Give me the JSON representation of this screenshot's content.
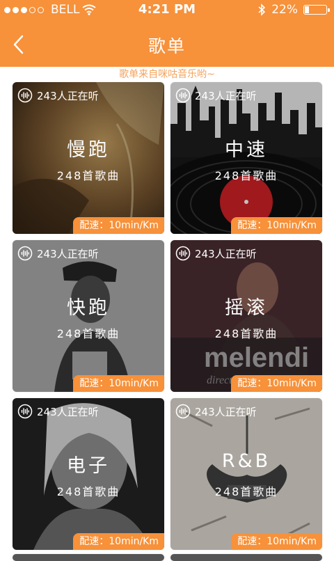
{
  "status_bar": {
    "carrier": "BELL",
    "time": "4:21 PM",
    "battery": "22%",
    "battery_level": 0.22,
    "signal_bars_filled": 3,
    "signal_bars_total": 5
  },
  "nav": {
    "title": "歌单"
  },
  "subtitle": "歌单来自咪咕音乐哟~",
  "colors": {
    "accent": "#f7913a",
    "subtitle": "#f4a35c"
  },
  "playlists": [
    {
      "listeners": "243人正在听",
      "title": "慢跑",
      "count": "248首歌曲",
      "pace": "配速：10min/Km"
    },
    {
      "listeners": "243人正在听",
      "title": "中速",
      "count": "248首歌曲",
      "pace": "配速：10min/Km"
    },
    {
      "listeners": "243人正在听",
      "title": "快跑",
      "count": "248首歌曲",
      "pace": "配速：10min/Km"
    },
    {
      "listeners": "243人正在听",
      "title": "摇滚",
      "count": "248首歌曲",
      "pace": "配速：10min/Km"
    },
    {
      "listeners": "243人正在听",
      "title": "电子",
      "count": "248首歌曲",
      "pace": "配速：10min/Km"
    },
    {
      "listeners": "243人正在听",
      "title": "R&B",
      "count": "248首歌曲",
      "pace": "配速：10min/Km"
    }
  ],
  "card_art_text": {
    "rock": "melendi",
    "rock_sub": "direct"
  }
}
